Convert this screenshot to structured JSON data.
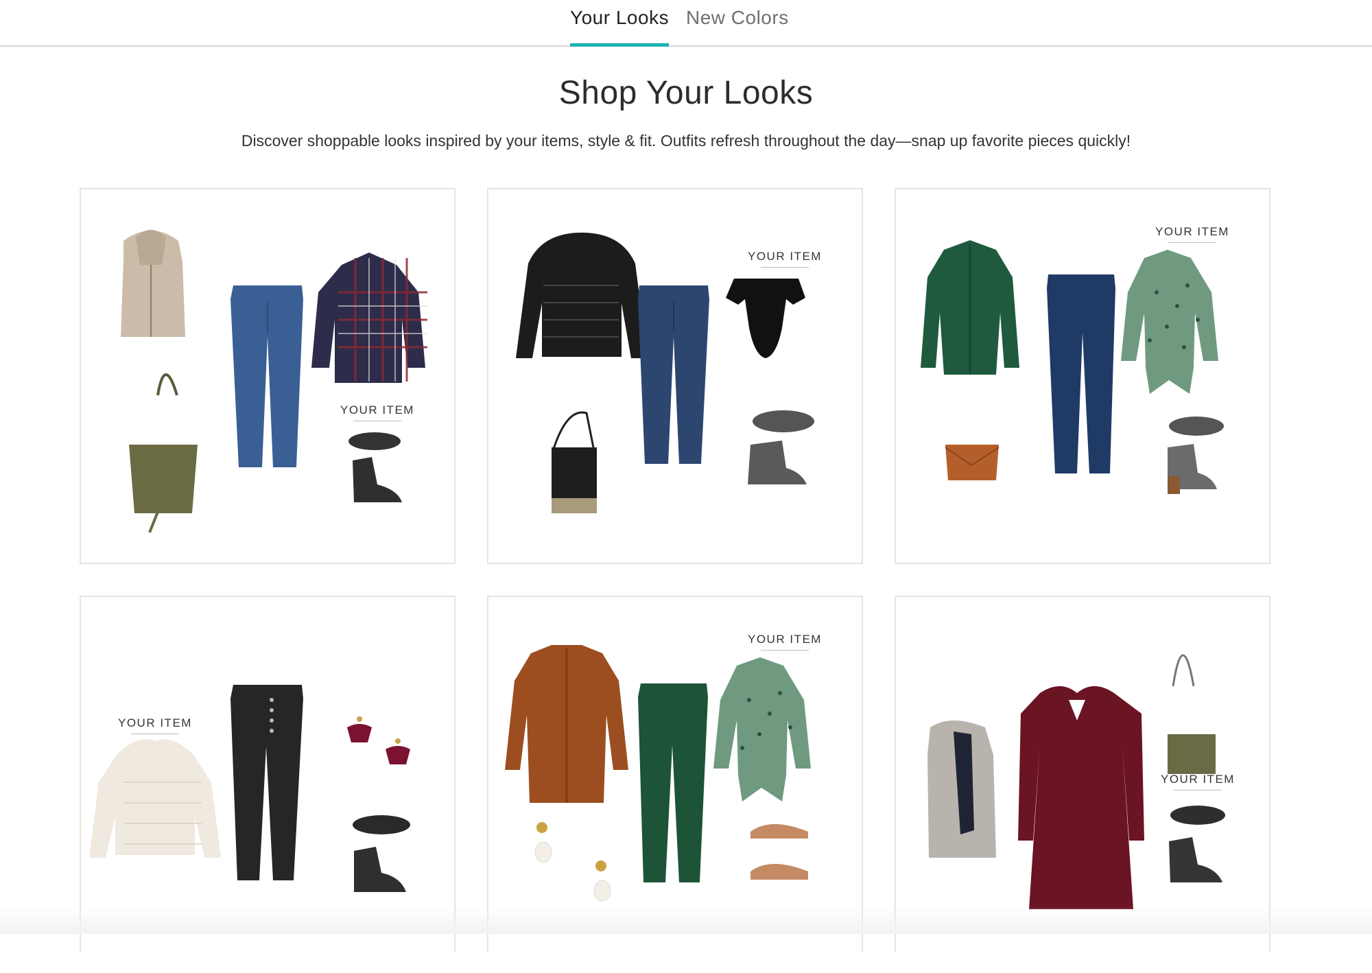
{
  "tabs": [
    {
      "label": "Your Looks",
      "active": true
    },
    {
      "label": "New Colors",
      "active": false
    }
  ],
  "page": {
    "title": "Shop Your Looks",
    "subtitle": "Discover shoppable looks inspired by your items, style & fit. Outfits refresh throughout the day—snap up favorite pieces quickly!"
  },
  "your_item_label": "YOUR ITEM",
  "accent_color": "#1fb3b0",
  "looks": [
    {
      "items": [
        "sherpa-vest",
        "olive-tote",
        "blue-jeans",
        "plaid-shirt",
        "black-ankle-booties"
      ],
      "your_item": "black-ankle-booties"
    },
    {
      "items": [
        "quilted-hooded-jacket",
        "crossbody-bag",
        "dark-jeans",
        "off-shoulder-bodysuit",
        "grey-booties"
      ],
      "your_item": "off-shoulder-bodysuit"
    },
    {
      "items": [
        "green-cardigan",
        "tan-crossbody",
        "dark-jeans",
        "green-tie-blouse",
        "grey-booties"
      ],
      "your_item": "green-tie-blouse"
    },
    {
      "items": [
        "cream-sweater",
        "black-jeans",
        "tassel-earrings",
        "black-booties"
      ],
      "your_item": "cream-sweater"
    },
    {
      "items": [
        "rust-cardigan",
        "pearl-earrings",
        "green-jeans",
        "green-tie-blouse",
        "tan-mules"
      ],
      "your_item": "green-tie-blouse"
    },
    {
      "items": [
        "faux-fur-vest",
        "burgundy-dress",
        "olive-crossbody",
        "black-booties"
      ],
      "your_item": "black-booties"
    }
  ]
}
